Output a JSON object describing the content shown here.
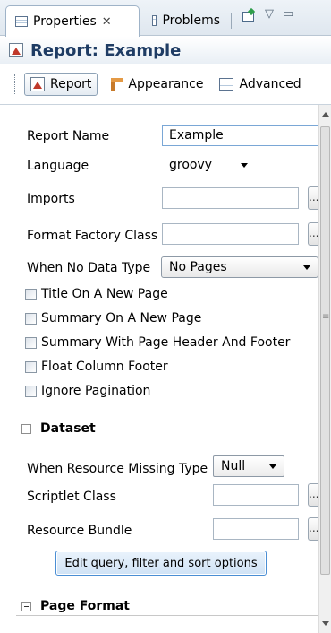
{
  "tabs": {
    "properties_label": "Properties",
    "properties_close": "✕",
    "problems_label": "Problems"
  },
  "header": {
    "title": "Report: Example"
  },
  "section_tabs": [
    {
      "label": "Report"
    },
    {
      "label": "Appearance"
    },
    {
      "label": "Advanced"
    }
  ],
  "form": {
    "report_name_label": "Report Name",
    "report_name_value": "Example",
    "language_label": "Language",
    "language_value": "groovy",
    "imports_label": "Imports",
    "imports_value": "",
    "format_factory_label": "Format Factory Class",
    "format_factory_value": "",
    "when_no_data_label": "When No Data Type",
    "when_no_data_value": "No Pages",
    "browse_label": "..."
  },
  "checkboxes": [
    {
      "label": "Title On A New Page",
      "checked": false
    },
    {
      "label": "Summary On A New Page",
      "checked": false
    },
    {
      "label": "Summary With Page Header And Footer",
      "checked": false
    },
    {
      "label": "Float Column Footer",
      "checked": false
    },
    {
      "label": "Ignore Pagination",
      "checked": false
    }
  ],
  "dataset": {
    "title": "Dataset",
    "resource_missing_label": "When Resource Missing Type",
    "resource_missing_value": "Null",
    "scriptlet_label": "Scriptlet Class",
    "scriptlet_value": "",
    "resource_bundle_label": "Resource Bundle",
    "resource_bundle_value": "",
    "edit_query_button": "Edit query, filter and sort options"
  },
  "page_format": {
    "title": "Page Format"
  }
}
